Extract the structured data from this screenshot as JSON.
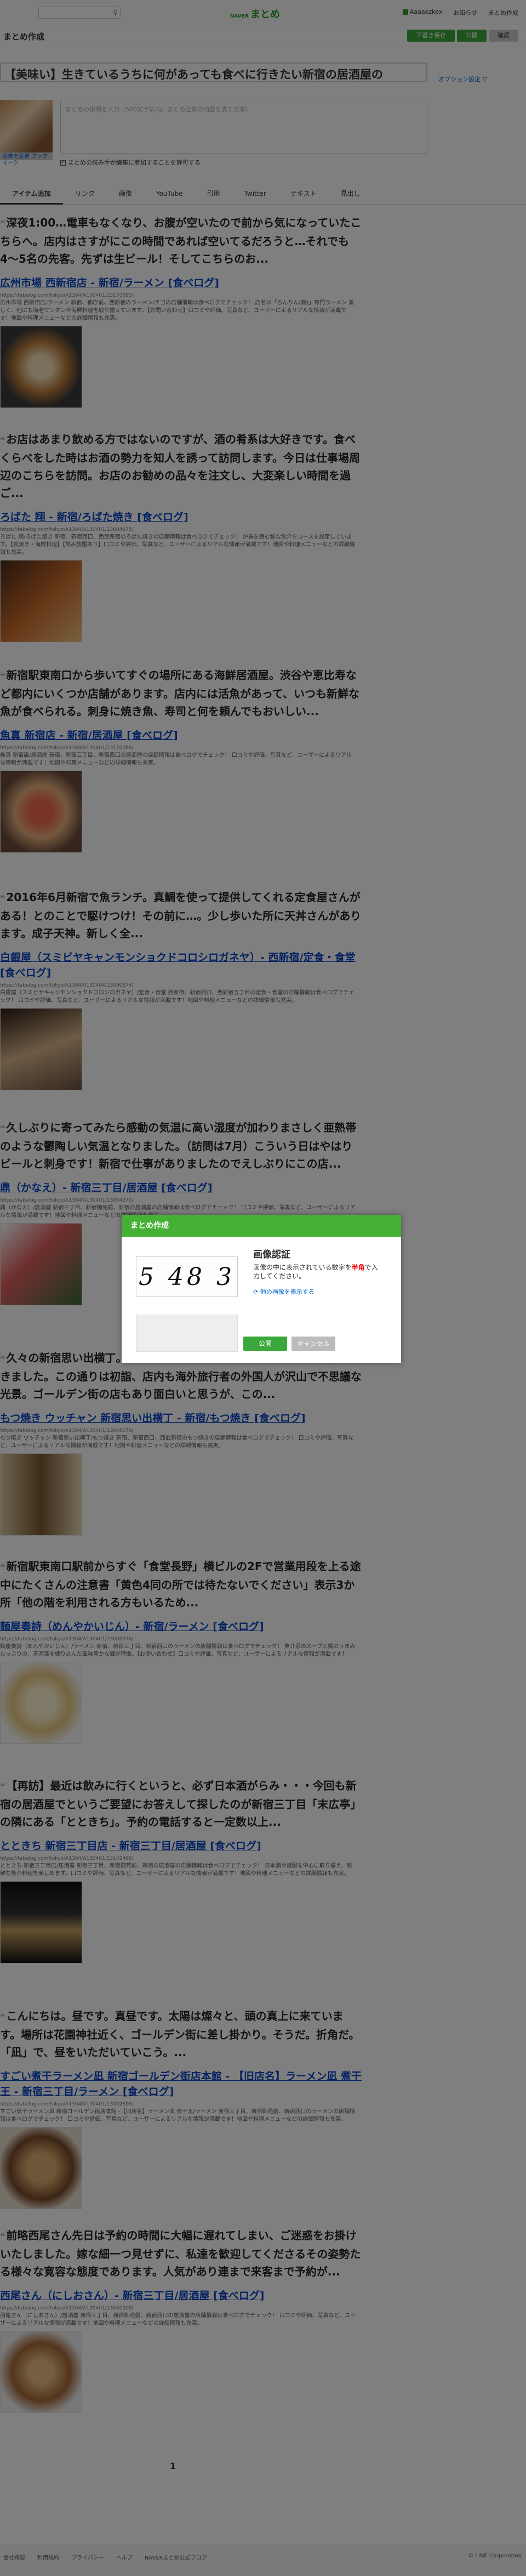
{
  "header": {
    "search_placeholder": "",
    "logo_brand": "NAVER",
    "logo_text": "まとめ",
    "user_links": [
      "Aaaaezkex",
      "お知らせ",
      "まとめ作成"
    ]
  },
  "subbar": {
    "title": "まとめ作成",
    "buttons": [
      "下書き保存",
      "公開",
      "確認"
    ]
  },
  "editor": {
    "title": "【美味い】生きているうちに何があっても食べに行きたい新宿の居酒屋の",
    "option_link": "オプション設定 ▽",
    "thumb_link": "画像を変更 ブックマーク",
    "description_placeholder": "まとめの説明を入力（500文字以内。まとめ全体の内容を表す文章）",
    "checkbox_label": "まとめの読み手が編集に参加することを許可する",
    "checkbox_checked": "✓"
  },
  "tabs": [
    "アイテム追加",
    "リンク",
    "画像",
    "YouTube",
    "引用",
    "Twitter",
    "テキスト",
    "見出し"
  ],
  "items": [
    {
      "quote": "深夜1:00…電車もなくなり、お腹が空いたので前から気になっていたこちらへ。店内はさすがにこの時間であれば空いてるだろうと…それでも4〜5名の先客。先ずは生ビール！そしてこちらのお...",
      "title": "広州市場 西新宿店 - 新宿/ラーメン [食べログ]",
      "url": "https://tabelog.com/tokyo/A1304/A130401/13170685/",
      "desc": "広州市場 西新宿店/ラーメン 新宿、都庁前、西新宿のラーメン/チゴの店舗情報は食べログでチェック！ 店名は「ろんりん(麺)」専門ラーメン 激しく、他にも海老ワンタンや海鮮料理を取り揃えています。【お問い合わせ】口コミや評価、写真など、ユーザーによるリアルな情報が満載です！地図や料理メニューなどの詳細情報も充実。"
    },
    {
      "quote": "お店はあまり飲める方ではないのですが、酒の肴系は大好きです。食べくらべをした時はお酒の勢力を知人を誘って訪問します。今日は仕事場周辺のこちらを訪問。お店のお勧めの品々を注文し、大変楽しい時間を過ご...",
      "title": "ろばた 翔 - 新宿/ろばた焼き [食べログ]",
      "url": "https://tabelog.com/tokyo/A1304/A130401/13004675/",
      "desc": "ろばた 翔/ろばた焼き 新宿、新宿西口、西武新宿のろばた焼きの店舗情報は食べログでチェック！ 炉端を囲む鮮な魚介をコースを設定しています。【炭焼き・海鮮料理】【飲み放題あり】口コミや評価、写真など、ユーザーによるリアルな情報が満載です！地図や料理メニューなどの詳細情報も充実。"
    },
    {
      "quote": "新宿駅東南口から歩いてすぐの場所にある海鮮居酒屋。渋谷や恵比寿など都内にいくつか店舗があります。店内には活魚があって、いつも新鮮な魚が食べられる。刺身に焼き魚、寿司と何を頼んでもおいしい...",
      "title": "魚真 新宿店 - 新宿/居酒屋 [食べログ]",
      "url": "https://tabelog.com/tokyo/A1304/A130401/13120066/",
      "desc": "魚真 新宿店/居酒屋 新宿、新宿三丁目、新宿西口の居酒屋の店舗情報は食べログでチェック！ 口コミや評価、写真など、ユーザーによるリアルな情報が満載です！地図や料理メニューなどの詳細情報も充実。"
    },
    {
      "quote": "2016年6月新宿で魚ランチ。真鯛を使って提供してくれる定食屋さんがある！とのことで駆けつけ！その前に…。少し歩いた所に天丼さんがあります。成子天神。新しく全...",
      "title": "白銀屋（スミビヤキャンモンショクドコロシロガネヤ）- 西新宿/定食・食堂 [食べログ]",
      "url": "https://tabelog.com/tokyo/A1304/A130404/13090874/",
      "desc": "白銀屋（スミビヤキャンモンショクドコロシロガネヤ）/定食・食堂 西新宿、新宿西口、西新宿五丁目の定食・食堂の店舗情報は食べログでチェック！ 口コミや評価、写真など、ユーザーによるリアルな情報が満載です！地図や料理メニューなどの詳細情報も充実。"
    },
    {
      "quote": "久しぶりに寄ってみたら感動の気温に高い湿度が加わりまさしく亜熱帯のような鬱陶しい気温となりました。（訪問は7月）こういう日はやはりビールと刺身です！新宿で仕事がありましたのでえしぶりにこの店...",
      "title": "鼎（かなえ）- 新宿三丁目/居酒屋 [食べログ]",
      "url": "https://tabelog.com/tokyo/A1304/A130401/13004270/",
      "desc": "鼎（かなえ）/居酒屋 新宿三丁目、新宿御苑前、新宿の居酒屋の店舗情報は食べログでチェック！ 口コミや評価、写真など、ユーザーによるリアルな情報が満載です！地図や料理メニューなどの詳細情報も充実。"
    },
    {
      "quote": "久々の新宿思い出横丁。その中にある、もつ焼き屋さんに初めて行ってきました。この通りは初詣、店内も海外旅行者の外国人が沢山で不思議な光景。ゴールデン街の店もあり面白いと思うが、この...",
      "title": "もつ焼き ウッチャン 新宿思い出横丁 - 新宿/もつ焼き [食べログ]",
      "url": "https://tabelog.com/tokyo/A1304/A130401/13045078/",
      "desc": "もつ焼き ウッチャン 新宿思い出横丁/もつ焼き 新宿、新宿西口、西武新宿のもつ焼きの店舗情報は食べログでチェック！ 口コミや評価、写真など、ユーザーによるリアルな情報が満載です！地図や料理メニューなどの詳細情報も充実。"
    },
    {
      "quote": "新宿駅東南口駅前からすぐ「食堂長野」横ビルの2Fで営業用段を上る途中にたくさんの注意書「黄色4同の所では待たないでください」表示3か所「他の階を利用される方もいるため...",
      "title": "麺屋奏詩（めんやかいじん）- 新宿/ラーメン [食べログ]",
      "url": "https://tabelog.com/tokyo/A1304/A130401/13009076/",
      "desc": "麺屋奏詩（めんやかいじん）/ラーメン 新宿、新宿三丁目、新宿西口のラーメンの店舗情報は食べログでチェック！ 魚介系のスープと鶏のうまみたっぷりの、天海藻を練り込んだ風味豊かな麺が特徴。【お問い合わせ】口コミや評価、写真など、ユーザーによるリアルな情報が満載です！"
    },
    {
      "quote": "【再訪】最近は飲みに行くというと、必ず日本酒がらみ・・・今回も新宿の居酒屋でというご要望にお答えして探したのが新宿三丁目「末広亭」の隣にある「とときち」。予約の電話すると一定数以上...",
      "title": "とときち 新宿三丁目店 - 新宿三丁目/居酒屋 [食べログ]",
      "url": "https://tabelog.com/tokyo/A1304/A130401/13142468/",
      "desc": "とときち 新宿三丁目店/居酒屋 新宿三丁目、新宿御苑前、新宿の居酒屋の店舗情報は食べログでチェック！ 日本酒や焼酎を中心に取り揃え、新鮮な魚介料理を楽しめます。口コミや評価、写真など、ユーザーによるリアルな情報が満載です！地図や料理メニューなどの詳細情報も充実。"
    },
    {
      "quote": "こんにちは。昼です。真昼です。太陽は燦々と、頭の真上に来ています。場所は花園神社近く、ゴールデン街に差し掛かり。そうだ。折角だ。「凪」で、昼をいただいていこう。...",
      "title": "すごい煮干ラーメン凪 新宿ゴールデン街店本館 - 【旧店名】ラーメン凪 煮干王 - 新宿三丁目/ラーメン [食べログ]",
      "url": "https://tabelog.com/tokyo/A1304/A130401/13002896/",
      "desc": "すごい煮干ラーメン凪 新宿ゴールデン街店本館 -【旧店名】ラーメン凪 煮干王/ラーメン 新宿三丁目、新宿御苑前、新宿西口のラーメンの店舗情報は食べログでチェック！ 口コミや評価、写真など、ユーザーによるリアルな情報が満載です！地図や料理メニューなどの詳細情報も充実。"
    },
    {
      "quote": "前略西尾さん先日は予約の時間に大幅に遅れてしまい、ご迷惑をお掛けいたしました。嫁な細一つ見せずに、私達を歓迎してくださるその姿勢たる様々な寛容な態度であります。人気があり連まで来客まで予約が...",
      "title": "西尾さん（にしおさん）- 新宿三丁目/居酒屋 [食べログ]",
      "url": "https://tabelog.com/tokyo/A1304/A130401/13080306/",
      "desc": "西尾さん（にしおさん）/居酒屋 新宿三丁目、新宿御苑前、新宿西口の居酒屋の店舗情報は食べログでチェック！ 口コミや評価、写真など、ユーザーによるリアルな情報が満載です！地図や料理メニューなどの詳細情報も充実。"
    }
  ],
  "pagination": {
    "current": "1"
  },
  "footer": {
    "links": [
      "会社概要",
      "利用規約",
      "プライバシー",
      "ヘルプ",
      "NAVERまとめ公式ブログ"
    ],
    "copyright": "© LINE Corporation"
  },
  "modal": {
    "header": "まとめ作成",
    "captcha_text": "5 48 3",
    "auth_title": "画像認証",
    "auth_msg_pre": "画像の中に表示されている数字を",
    "auth_msg_em": "半角",
    "auth_msg_post": "で入力してください。",
    "refresh_link": "他の画像を表示する",
    "submit": "公開",
    "cancel": "キャンセル"
  },
  "colors": {
    "accent": "#3ba83b",
    "link": "#0645c5"
  }
}
